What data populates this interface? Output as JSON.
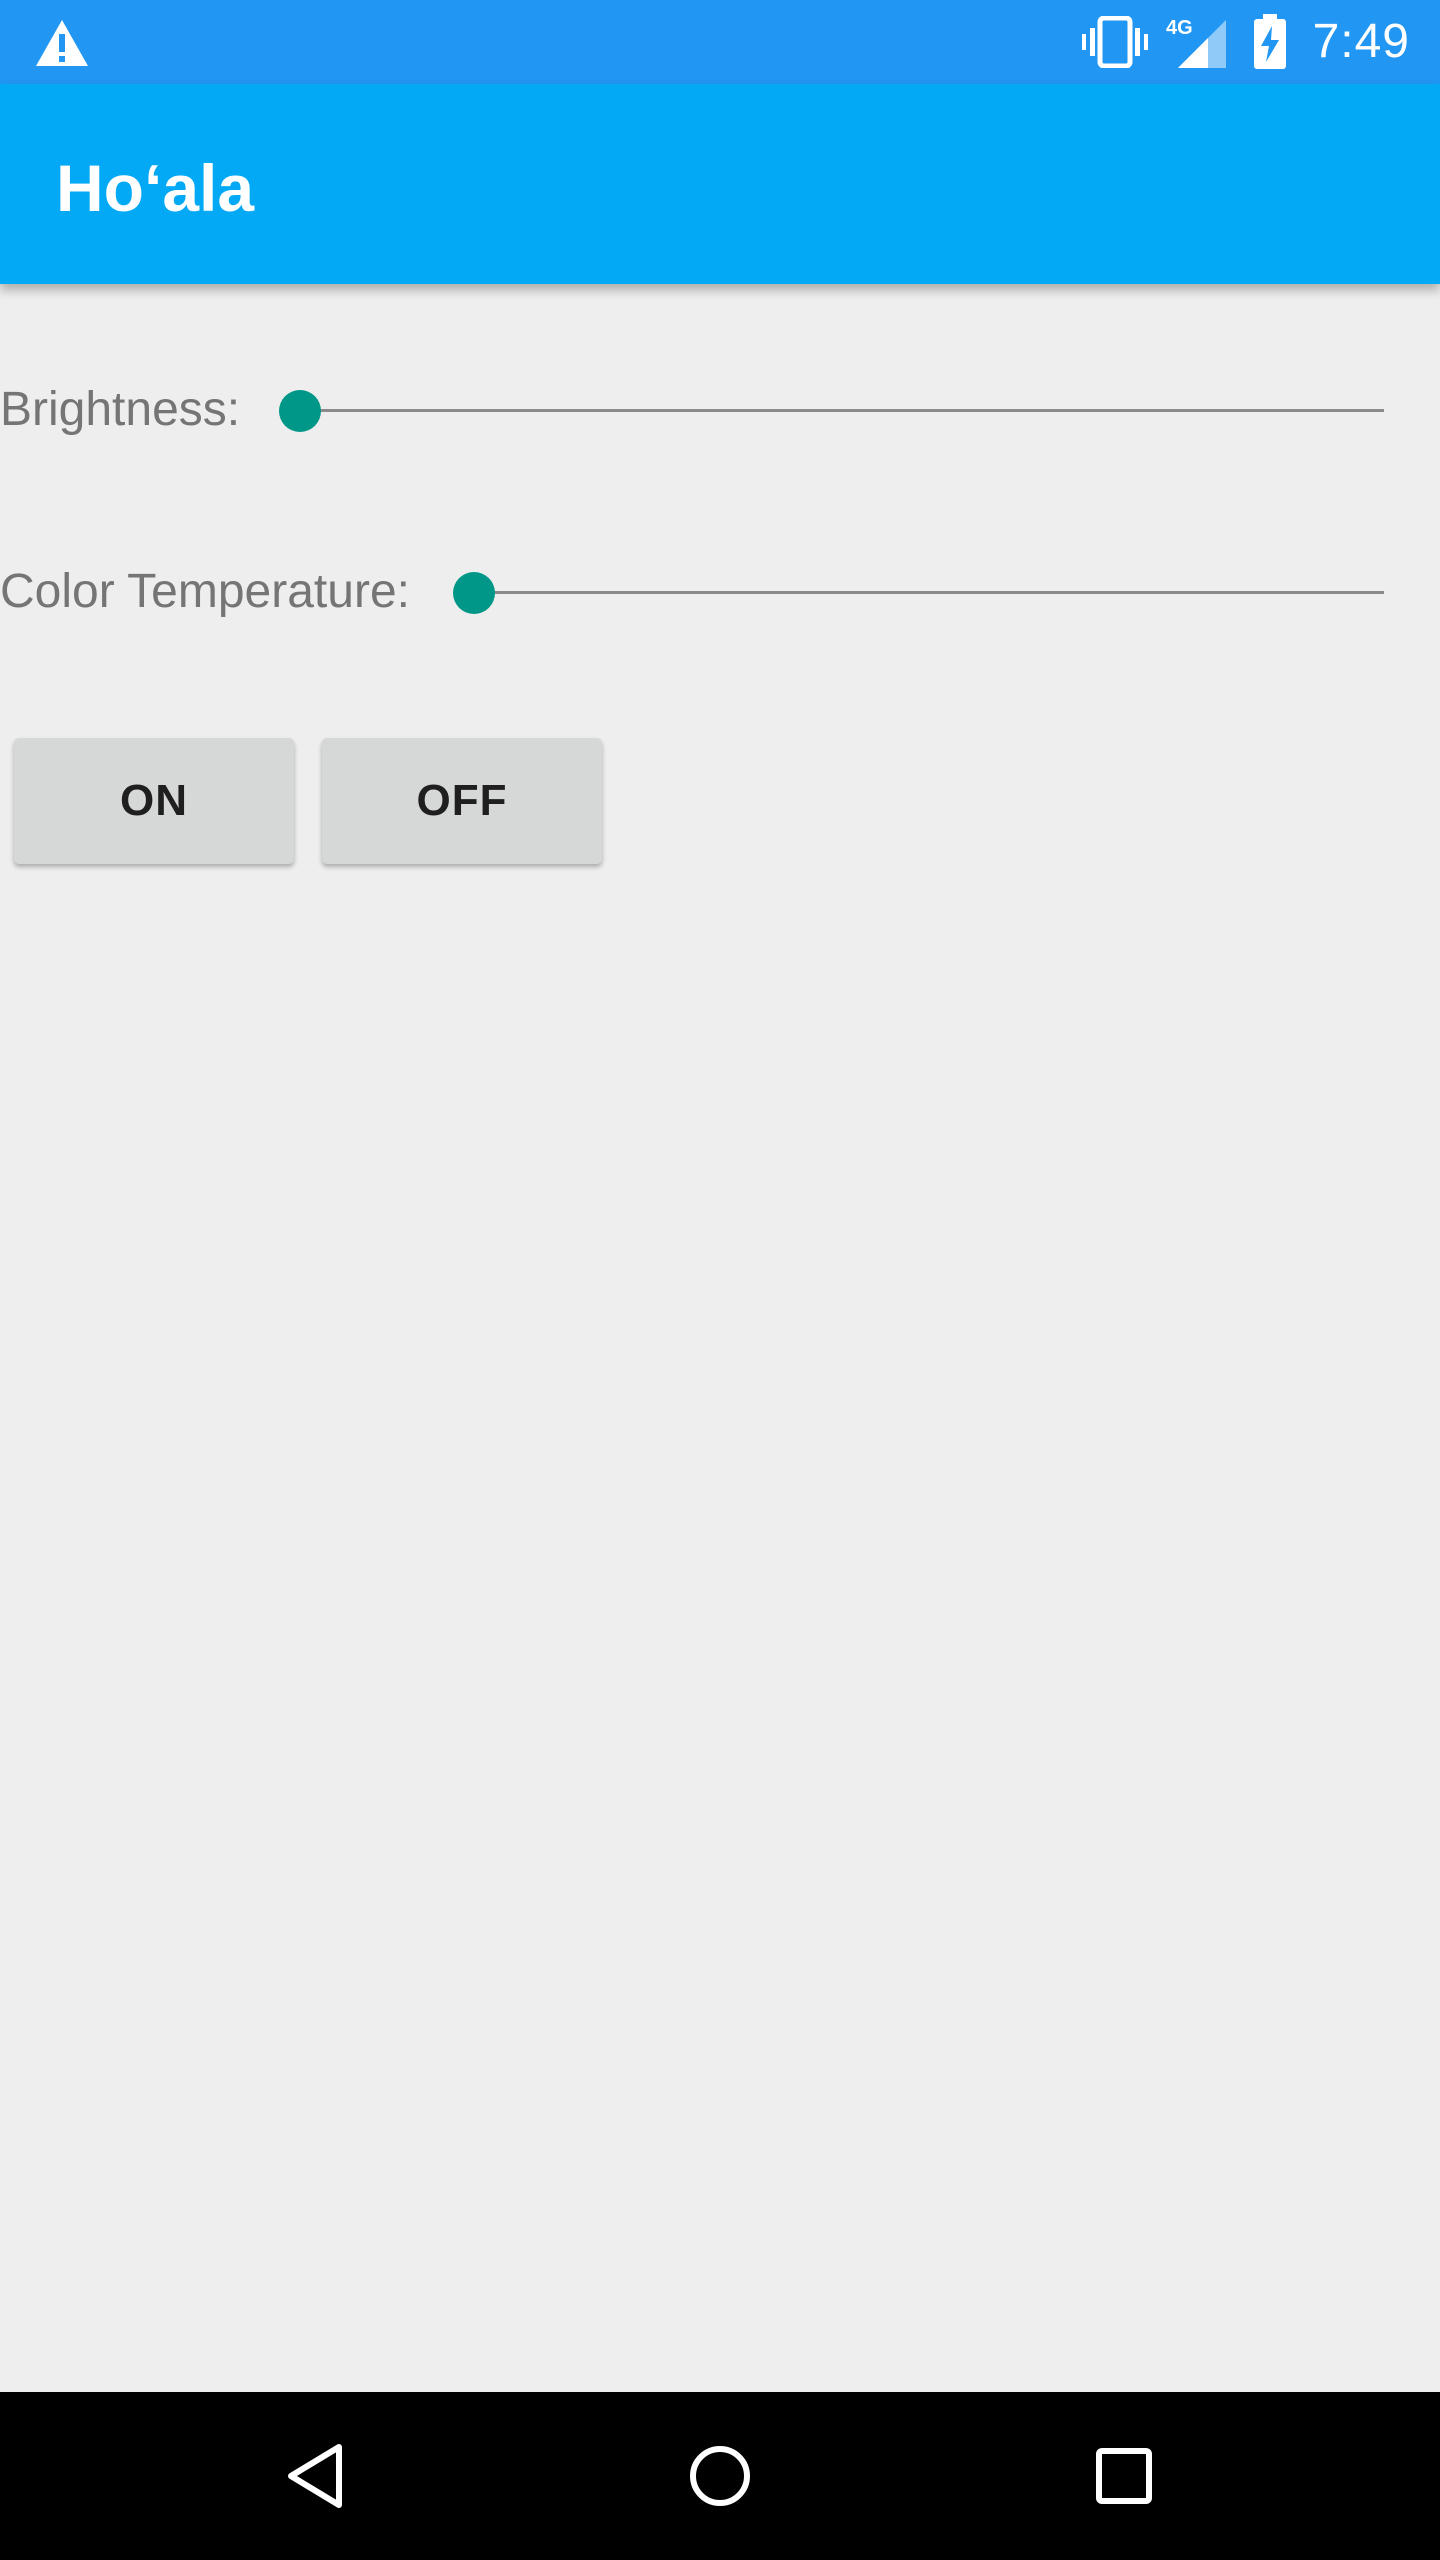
{
  "status_bar": {
    "time": "7:49",
    "network": "4G",
    "icons": [
      "warning-icon",
      "vibrate-icon",
      "signal-icon",
      "battery-charging-icon"
    ],
    "background": "#2196f3"
  },
  "app_bar": {
    "title": "Ho‘ala",
    "background": "#03a9f4"
  },
  "controls": {
    "brightness": {
      "label": "Brightness:",
      "value": 0
    },
    "color_temperature": {
      "label": "Color Temperature:",
      "value": 0
    },
    "accent": "#009688"
  },
  "buttons": {
    "on_label": "ON",
    "off_label": "OFF"
  },
  "nav_bar": {
    "icons": [
      "back-icon",
      "home-icon",
      "recents-icon"
    ]
  }
}
